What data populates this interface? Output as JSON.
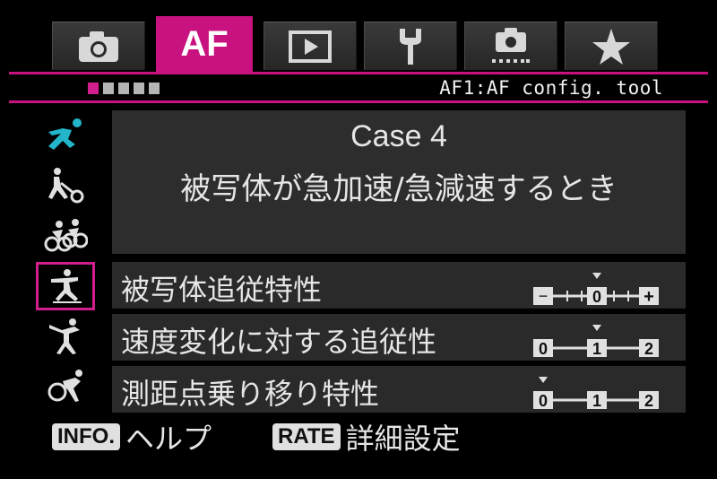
{
  "tabs": [
    {
      "name": "shooting",
      "icon": "camera-icon"
    },
    {
      "name": "af",
      "label": "AF",
      "active": true
    },
    {
      "name": "playback",
      "icon": "play-icon"
    },
    {
      "name": "setup",
      "icon": "wrench-icon"
    },
    {
      "name": "custom",
      "icon": "custom-camera-icon"
    },
    {
      "name": "mymenu",
      "icon": "star-icon"
    }
  ],
  "pager": {
    "total": 5,
    "current": 1
  },
  "menu_id": "AF1:AF config. tool",
  "cases": [
    {
      "icon": "runner-icon",
      "selected": false
    },
    {
      "icon": "tennis-player-icon",
      "selected": false
    },
    {
      "icon": "cyclists-icon",
      "selected": false
    },
    {
      "icon": "skater-icon",
      "selected": true
    },
    {
      "icon": "gymnast-icon",
      "selected": false
    },
    {
      "icon": "sprinter-icon",
      "selected": false
    }
  ],
  "description": {
    "title": "Case 4",
    "subtitle": "被写体が急加速/急減速するとき"
  },
  "params": [
    {
      "label": "被写体追従特性",
      "scale": [
        "−",
        "0",
        "+"
      ],
      "value": 0,
      "type": "tracking"
    },
    {
      "label": "速度変化に対する追従性",
      "scale": [
        "0",
        "1",
        "2"
      ],
      "value": 1,
      "type": "steps"
    },
    {
      "label": "測距点乗り移り特性",
      "scale": [
        "0",
        "1",
        "2"
      ],
      "value": 0,
      "type": "steps"
    }
  ],
  "footer": {
    "info_badge": "INFO.",
    "info_text": "ヘルプ",
    "rate_badge": "RATE",
    "rate_text": "詳細設定"
  }
}
